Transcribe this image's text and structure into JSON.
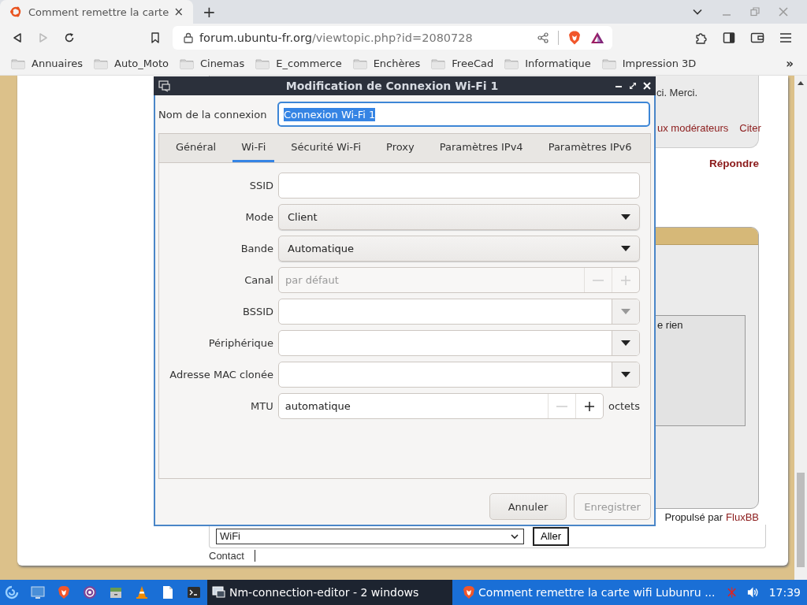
{
  "browser": {
    "tab": {
      "title": "Comment remettre la carte",
      "close": "×",
      "selected": true
    },
    "new_tab": "+",
    "url": {
      "host": "forum.ubuntu-fr.org",
      "path": "/viewtopic.php?id=2080728"
    },
    "nav": {
      "back_disabled": false,
      "forward_disabled": true
    },
    "bookmarks": [
      {
        "label": "Annuaires"
      },
      {
        "label": "Auto_Moto"
      },
      {
        "label": "Cinemas"
      },
      {
        "label": "E_commerce"
      },
      {
        "label": "Enchères"
      },
      {
        "label": "FreeCad"
      },
      {
        "label": "Informatique"
      },
      {
        "label": "Impression 3D"
      }
    ],
    "bookmarks_more": "»"
  },
  "forum": {
    "post_text": "ci. Merci.",
    "post_actions": [
      "ux modérateurs",
      "Citer"
    ],
    "reply_link": "Répondre",
    "quick_reply_text": "e rien",
    "powered_by": "Propulsé par",
    "powered_link": "FluxBB",
    "jump_select": "WiFi",
    "jump_button": "Aller",
    "footer_link": "Contact"
  },
  "dialog": {
    "title": "Modification de Connexion Wi-Fi 1",
    "name_label": "Nom de la connexion",
    "name_value": "Connexion Wi-Fi 1",
    "name_selected": true,
    "tabs": [
      {
        "label": "Général",
        "selected": false
      },
      {
        "label": "Wi-Fi",
        "selected": true
      },
      {
        "label": "Sécurité Wi-Fi",
        "selected": false
      },
      {
        "label": "Proxy",
        "selected": false
      },
      {
        "label": "Paramètres IPv4",
        "selected": false
      },
      {
        "label": "Paramètres IPv6",
        "selected": false
      }
    ],
    "rows": [
      {
        "label": "SSID",
        "kind": "entry"
      },
      {
        "label": "Mode",
        "kind": "combo",
        "value": "Client"
      },
      {
        "label": "Bande",
        "kind": "combo",
        "value": "Automatique"
      },
      {
        "label": "Canal",
        "kind": "spin",
        "placeholder": "par défaut",
        "disabled": true
      },
      {
        "label": "BSSID",
        "kind": "entry_combo",
        "arrow_disabled": true
      },
      {
        "label": "Périphérique",
        "kind": "entry_combo",
        "arrow_disabled": false
      },
      {
        "label": "Adresse MAC clonée",
        "kind": "entry_combo",
        "arrow_disabled": false
      },
      {
        "label": "MTU",
        "kind": "spin",
        "value": "automatique",
        "disabled": false,
        "minus_disabled": true,
        "unit": "octets"
      }
    ],
    "buttons": [
      {
        "label": "Annuler",
        "disabled": false
      },
      {
        "label": "Enregistrer",
        "disabled": true
      }
    ]
  },
  "taskbar": {
    "tasks": [
      {
        "label": "Nm-connection-editor - 2 windows",
        "selected": true
      },
      {
        "label": "Comment remettre la carte wifi Lubunru ...",
        "selected": false
      }
    ],
    "clock": "17:39"
  }
}
